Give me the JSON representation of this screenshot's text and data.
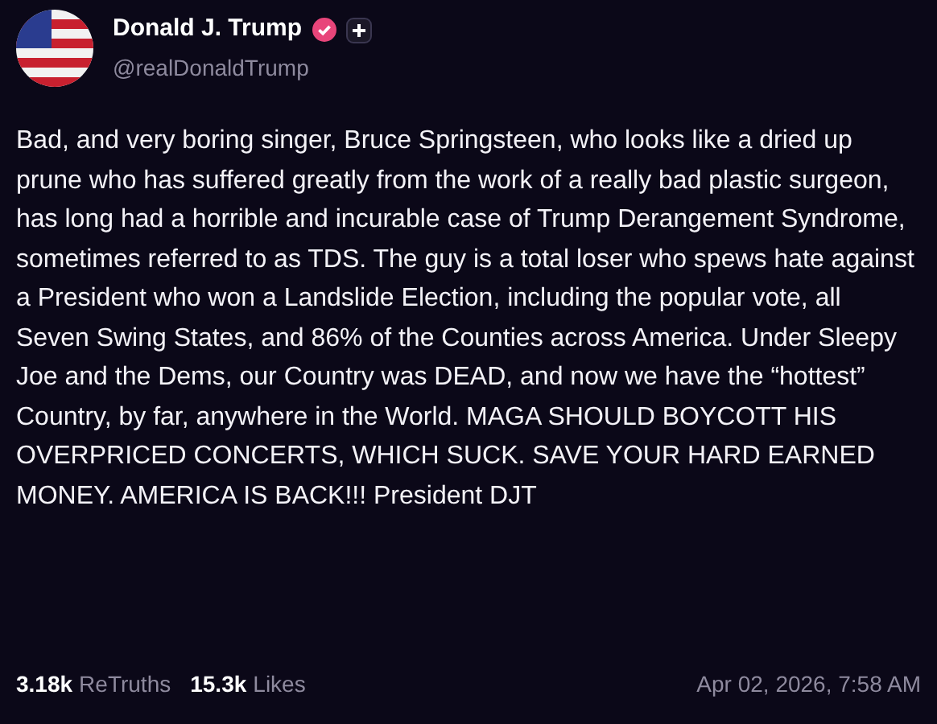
{
  "author": {
    "name": "Donald J. Trump",
    "handle": "@realDonaldTrump",
    "verified": true
  },
  "post": {
    "text": "Bad, and very boring singer, Bruce Springsteen, who looks like a dried up prune who has suffered greatly from the work of a really bad plastic surgeon, has long had a horrible and incurable case of Trump Derangement Syndrome, sometimes referred to as TDS. The guy is a total loser who spews hate against a President who won a Landslide Election, including the popular vote, all Seven Swing States, and 86% of the Counties across America. Under Sleepy Joe and the Dems, our Country was DEAD, and now we have the “hottest” Country, by far, anywhere in the World. MAGA SHOULD BOYCOTT HIS OVERPRICED CONCERTS, WHICH SUCK. SAVE YOUR HARD EARNED MONEY. AMERICA IS BACK!!! President DJT"
  },
  "stats": [
    {
      "count": "3.18k",
      "label": "ReTruths"
    },
    {
      "count": "15.3k",
      "label": "Likes"
    }
  ],
  "timestamp": "Apr 02, 2026, 7:58 AM"
}
